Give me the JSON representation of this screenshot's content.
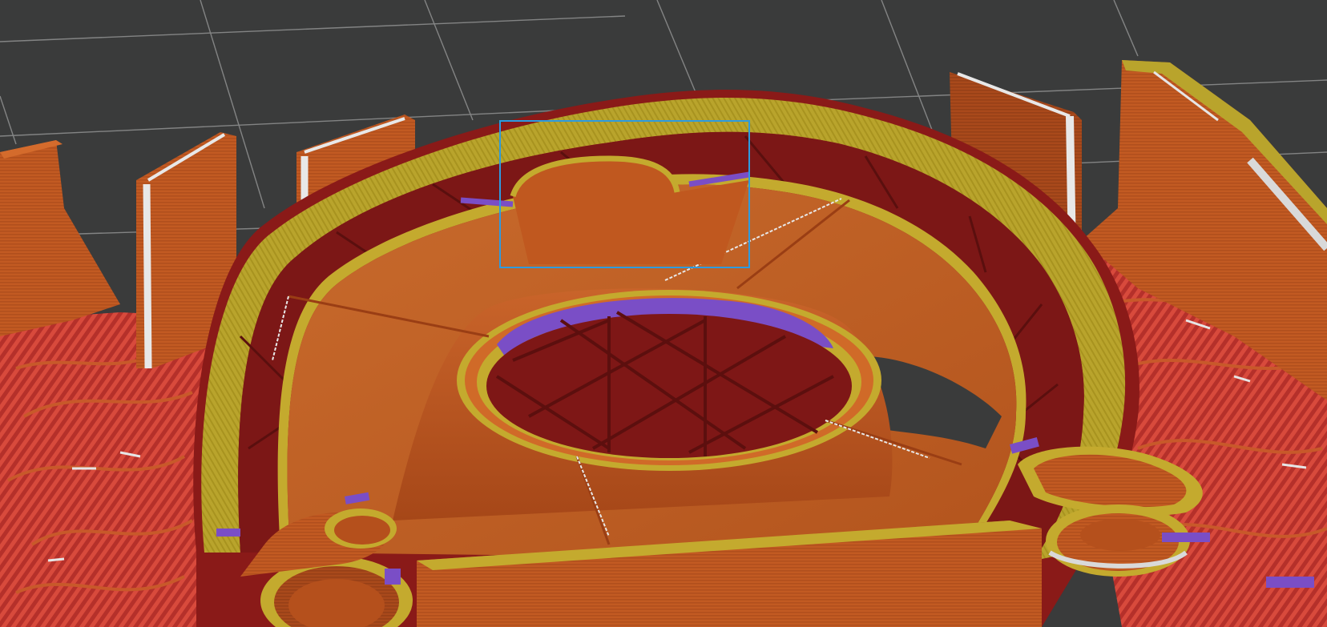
{
  "viewport": {
    "name": "3d-preview",
    "background_color": "#3a3b3b",
    "bed_grid_color": "#9a9b9b",
    "selection_box_color": "#2d9be0"
  },
  "feature_colors": {
    "perimeter": "#c4541e",
    "external_perimeter": "#a84a1c",
    "internal_infill": "#8a1a18",
    "solid_infill": "#b8a22a",
    "top_solid_infill": "#b8a22a",
    "bridge_infill": "#7a4ec6",
    "support": "#d84638",
    "wipe": "#e6e6e6"
  }
}
